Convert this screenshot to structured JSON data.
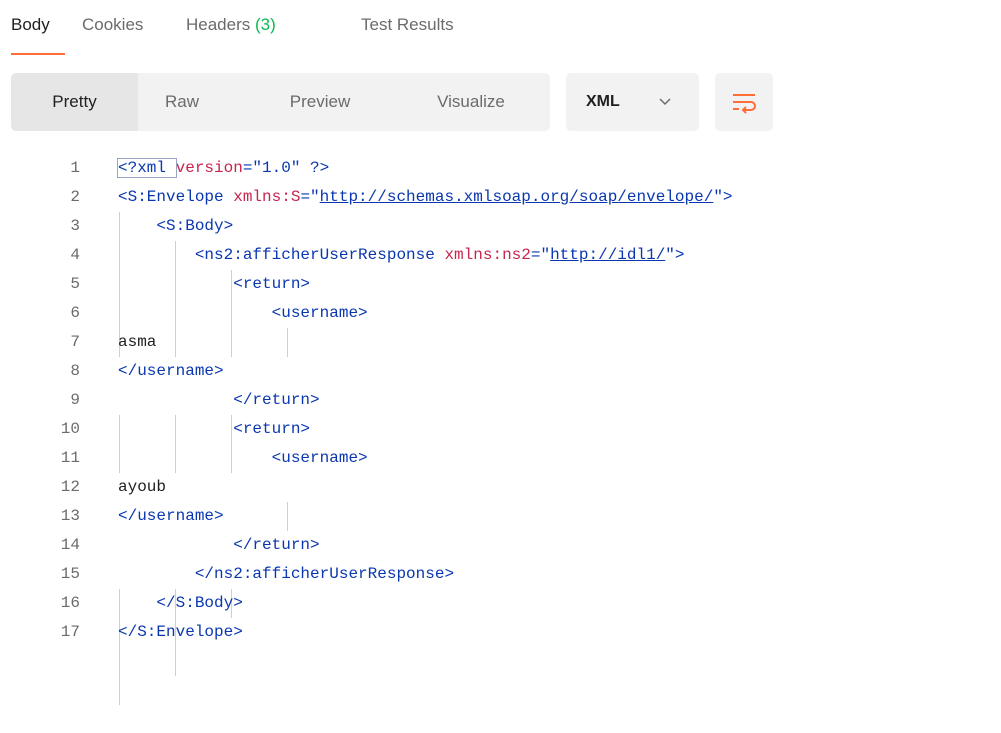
{
  "response_tabs": [
    {
      "label": "Body"
    },
    {
      "label": "Cookies"
    },
    {
      "label": "Headers",
      "count": "(3)"
    },
    {
      "label": "Test Results"
    }
  ],
  "view_modes": [
    {
      "label": "Pretty"
    },
    {
      "label": "Raw"
    },
    {
      "label": "Preview"
    },
    {
      "label": "Visualize"
    }
  ],
  "format_select": {
    "value": "XML"
  },
  "wrap_button": {
    "icon": "wrap-lines-icon"
  },
  "colors": {
    "accent": "#ff6c37",
    "count_green": "#0cbb52",
    "tag_blue": "#0a37b0",
    "attr_red": "#c7254e"
  },
  "code_lines": [
    {
      "num": "1",
      "t1": "<?xml ",
      "a1": "version",
      "e1": "=\"",
      "v1": "1.0",
      "t2": "\" ?>"
    },
    {
      "num": "2",
      "t1": "<S:Envelope ",
      "a1": "xmlns:S",
      "e1": "=\"",
      "v1": "http://schemas.xmlsoap.org/soap/envelope/",
      "t2": "\">"
    },
    {
      "num": "3",
      "t1": "    <S:Body>"
    },
    {
      "num": "4",
      "t1": "        <ns2:afficherUserResponse ",
      "a1": "xmlns:ns2",
      "e1": "=\"",
      "v1": "http://idl1/",
      "t2": "\">"
    },
    {
      "num": "5",
      "t1": "            <return>"
    },
    {
      "num": "6",
      "t1": "                <username>"
    },
    {
      "num": "7",
      "p1": "asma"
    },
    {
      "num": "8",
      "t1": "</username>"
    },
    {
      "num": "9",
      "t1": "            </return>"
    },
    {
      "num": "10",
      "t1": "            <return>"
    },
    {
      "num": "11",
      "t1": "                <username>"
    },
    {
      "num": "12",
      "p1": "ayoub"
    },
    {
      "num": "13",
      "t1": "</username>"
    },
    {
      "num": "14",
      "t1": "            </return>"
    },
    {
      "num": "15",
      "t1": "        </ns2:afficherUserResponse>"
    },
    {
      "num": "16",
      "t1": "    </S:Body>"
    },
    {
      "num": "17",
      "t1": "</S:Envelope>"
    }
  ]
}
